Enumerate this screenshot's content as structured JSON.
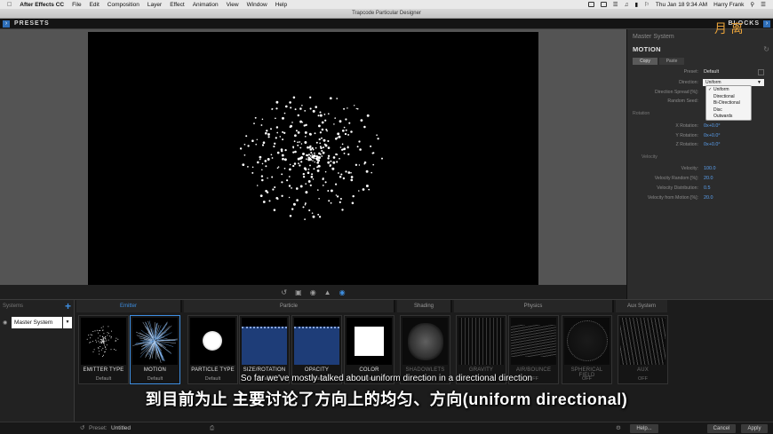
{
  "menubar": {
    "app_name": "After Effects CC",
    "items": [
      "File",
      "Edit",
      "Composition",
      "Layer",
      "Effect",
      "Animation",
      "View",
      "Window",
      "Help"
    ],
    "clock": "Thu Jan 18  9:34 AM",
    "user": "Harry Frank"
  },
  "window": {
    "title": "Trapcode Particular Designer"
  },
  "header": {
    "presets_label": "PRESETS",
    "blocks_label": "BLOCKS"
  },
  "inspector": {
    "system_name": "Master System",
    "title": "MOTION",
    "tabs": [
      "Copy",
      "Paste"
    ],
    "preset_label": "Preset:",
    "preset_value": "Default",
    "direction_label": "Direction:",
    "direction_value": "Uniform",
    "direction_options": [
      "Uniform",
      "Directional",
      "Bi-Directional",
      "Disc",
      "Outwards"
    ],
    "direction_spread_label": "Direction Spread [%]:",
    "random_seed_label": "Random Seed:",
    "rotation_group": "Rotation",
    "x_rotation_label": "X Rotation:",
    "x_rotation_value": "0x+0.0°",
    "y_rotation_label": "Y Rotation:",
    "y_rotation_value": "0x+0.0°",
    "z_rotation_label": "Z Rotation:",
    "z_rotation_value": "0x+0.0°",
    "velocity_group": "Velocity",
    "velocity_label": "Velocity:",
    "velocity_value": "100.0",
    "velocity_random_label": "Velocity Random [%]:",
    "velocity_random_value": "20.0",
    "velocity_distribution_label": "Velocity Distribution:",
    "velocity_distribution_value": "0.5",
    "velocity_from_motion_label": "Velocity from Motion [%]:",
    "velocity_from_motion_value": "20.0"
  },
  "systems": {
    "header": "Systems",
    "selected": "Master System"
  },
  "categories": [
    "Emitter",
    "Particle",
    "Shading",
    "Physics",
    "Aux System"
  ],
  "cards": [
    {
      "title": "EMITTER TYPE",
      "sub": "Default"
    },
    {
      "title": "MOTION",
      "sub": "Default"
    },
    {
      "title": "PARTICLE TYPE",
      "sub": "Default"
    },
    {
      "title": "SIZE/ROTATION",
      "sub": "Default"
    },
    {
      "title": "OPACITY",
      "sub": "Default"
    },
    {
      "title": "COLOR",
      "sub": "Default"
    },
    {
      "title": "SHADOWLETS",
      "sub": "OFF"
    },
    {
      "title": "GRAVITY",
      "sub": "OFF"
    },
    {
      "title": "AIR/BOUNCE",
      "sub": "OFF"
    },
    {
      "title": "SPHERICAL FIELD",
      "sub": "OFF"
    },
    {
      "title": "AUX",
      "sub": "OFF"
    }
  ],
  "footer": {
    "preset_label": "Preset:",
    "preset_value": "Untitled",
    "help": "Help...",
    "cancel": "Cancel",
    "apply": "Apply"
  },
  "subtitles": {
    "english": "So far we've mostly talked about uniform direction in a directional direction",
    "chinese": "到目前为止 主要讨论了方向上的均匀、方向(uniform directional)"
  },
  "watermark": "月 离",
  "colors": {
    "accent": "#3e8ee0",
    "selected_border": "#3e8ee0",
    "viewport_bg": "#000000"
  }
}
